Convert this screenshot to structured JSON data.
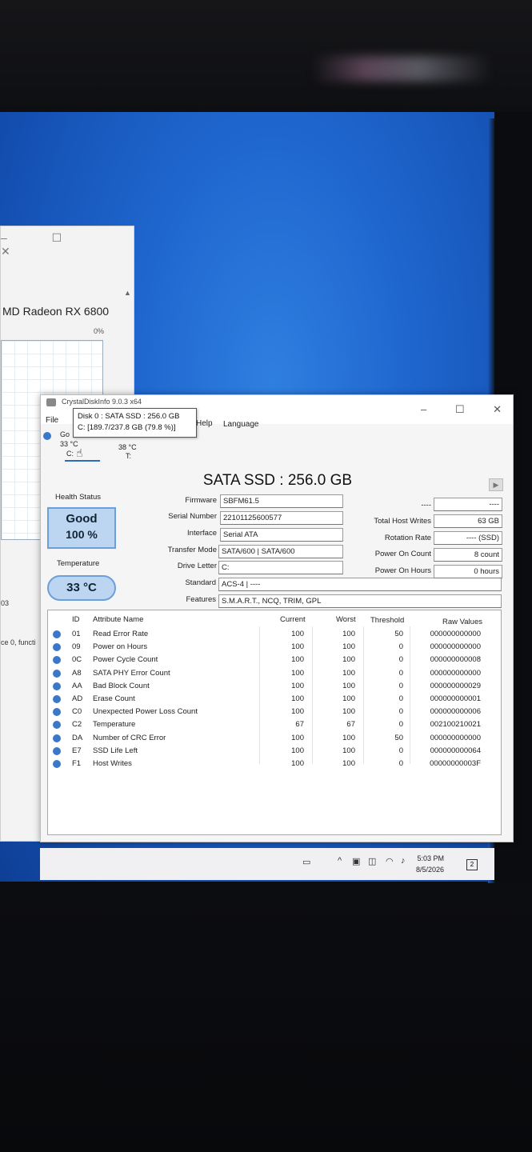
{
  "background_window": {
    "gpu_name": "MD Radeon RX 6800",
    "gpu_pct": "0%",
    "side_a": "03",
    "side_b": "ce 0, functi",
    "controls": "–  ☐  ✕"
  },
  "window": {
    "title": "CrystalDiskInfo 9.0.3 x64",
    "controls": {
      "minimize": "–",
      "maximize": "☐",
      "close": "✕"
    },
    "menu": {
      "file": "File",
      "help": "Help",
      "language": "Language"
    }
  },
  "disks": [
    {
      "status": "Go",
      "temp": "33 °C",
      "letter": "C:"
    },
    {
      "status": "",
      "temp": "38 °C",
      "letter": "T:"
    }
  ],
  "tooltip": {
    "line1": "Disk 0 : SATA SSD : 256.0 GB",
    "line2": "C: [189.7/237.8 GB (79.8 %)]"
  },
  "model": "SATA SSD : 256.0 GB",
  "health": {
    "label": "Health Status",
    "status": "Good",
    "percent": "100 %"
  },
  "temperature": {
    "label": "Temperature",
    "value": "33 °C"
  },
  "info": {
    "firmware_label": "Firmware",
    "firmware": "SBFM61.5",
    "serial_label": "Serial Number",
    "serial": "22101125600577",
    "interface_label": "Interface",
    "interface": "Serial ATA",
    "transfer_label": "Transfer Mode",
    "transfer": "SATA/600 | SATA/600",
    "drive_letter_label": "Drive Letter",
    "drive_letter": "C:",
    "standard_label": "Standard",
    "standard": "ACS-4 | ----",
    "features_label": "Features",
    "features": "S.M.A.R.T., NCQ, TRIM, GPL"
  },
  "right_info": {
    "top_label": "----",
    "top_value": "----",
    "writes_label": "Total Host Writes",
    "writes": "63 GB",
    "rotation_label": "Rotation Rate",
    "rotation": "---- (SSD)",
    "power_count_label": "Power On Count",
    "power_count": "8 count",
    "power_hours_label": "Power On Hours",
    "power_hours": "0 hours"
  },
  "smart": {
    "headers": {
      "id": "ID",
      "name": "Attribute Name",
      "current": "Current",
      "worst": "Worst",
      "threshold": "Threshold",
      "raw": "Raw Values"
    },
    "rows": [
      {
        "id": "01",
        "name": "Read Error Rate",
        "current": "100",
        "worst": "100",
        "threshold": "50",
        "raw": "000000000000"
      },
      {
        "id": "09",
        "name": "Power on Hours",
        "current": "100",
        "worst": "100",
        "threshold": "0",
        "raw": "000000000000"
      },
      {
        "id": "0C",
        "name": "Power Cycle Count",
        "current": "100",
        "worst": "100",
        "threshold": "0",
        "raw": "000000000008"
      },
      {
        "id": "A8",
        "name": "SATA PHY Error Count",
        "current": "100",
        "worst": "100",
        "threshold": "0",
        "raw": "000000000000"
      },
      {
        "id": "AA",
        "name": "Bad Block Count",
        "current": "100",
        "worst": "100",
        "threshold": "0",
        "raw": "000000000029"
      },
      {
        "id": "AD",
        "name": "Erase Count",
        "current": "100",
        "worst": "100",
        "threshold": "0",
        "raw": "000000000001"
      },
      {
        "id": "C0",
        "name": "Unexpected Power Loss Count",
        "current": "100",
        "worst": "100",
        "threshold": "0",
        "raw": "000000000006"
      },
      {
        "id": "C2",
        "name": "Temperature",
        "current": "67",
        "worst": "67",
        "threshold": "0",
        "raw": "002100210021"
      },
      {
        "id": "DA",
        "name": "Number of CRC Error",
        "current": "100",
        "worst": "100",
        "threshold": "50",
        "raw": "000000000000"
      },
      {
        "id": "E7",
        "name": "SSD Life Left",
        "current": "100",
        "worst": "100",
        "threshold": "0",
        "raw": "000000000064"
      },
      {
        "id": "F1",
        "name": "Host Writes",
        "current": "100",
        "worst": "100",
        "threshold": "0",
        "raw": "00000000003F"
      }
    ]
  },
  "taskbar": {
    "time": "5:03 PM",
    "date": "8/5/2026",
    "notifications": "2",
    "colors": {
      "status_blue": "#3a78c8",
      "health_fill": "#bcd6f2"
    }
  }
}
